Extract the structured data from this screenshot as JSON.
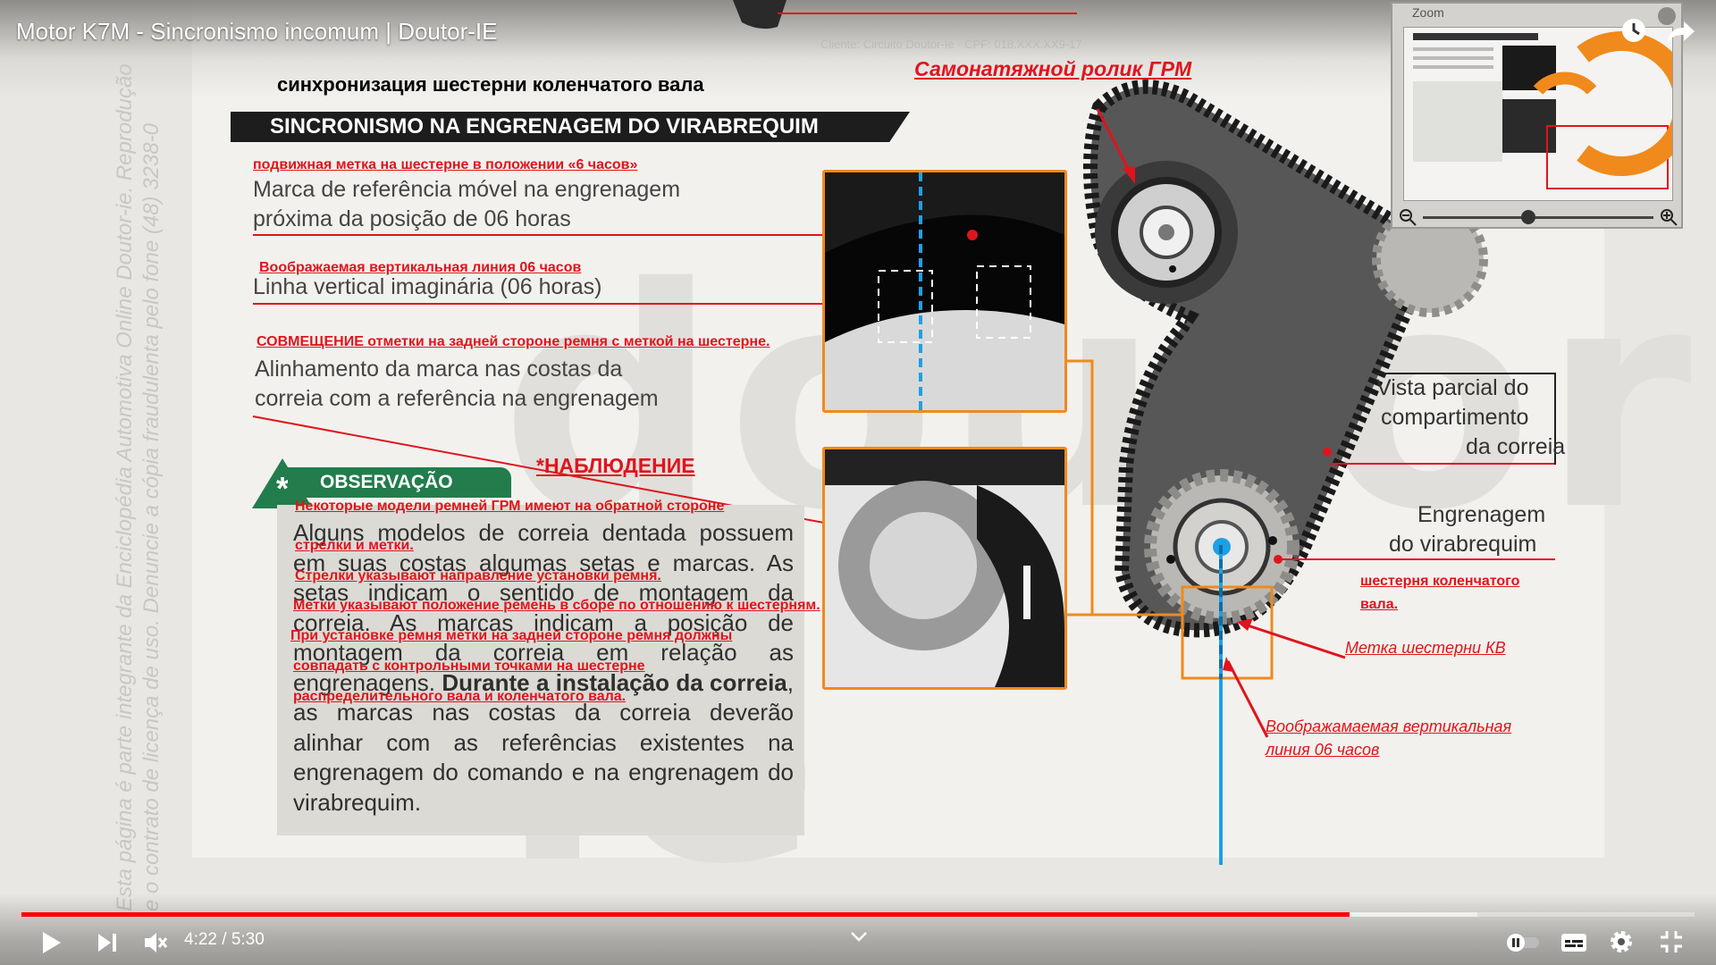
{
  "video": {
    "title": "Motor K7M - Sincronismo incomum | Doutor-IE",
    "time_current": "4:22",
    "time_separator": "/",
    "time_total": "5:30",
    "progress": 0.794,
    "buffered": 0.87
  },
  "page": {
    "client_line": "Cliente: Circuito Doutor-Ie · CPF: 018.XXX.XX9-17",
    "side_watermark_1": "Esta página é parte integrante da Enciclopédia Automotiva Online Doutor-ie. Reprodução",
    "side_watermark_2": "e o contrato de licença de uso. Denuncie a cópia fraudulenta pelo fone (48) 3238-0",
    "big_watermark": "doutor-ie",
    "ru_heading": "синхронизация шестерни коленчатого вала",
    "section_title": "SINCRONISMO NA ENGRENAGEM DO VIRABREQUIM",
    "ann_movable_mark": "подвижная метка на шестерне в положении «6 часов»",
    "pt_movable_1": "Marca de referência móvel na engrenagem",
    "pt_movable_2": "próxima da posição de 06 horas",
    "ann_vertical_line": "Воображаемая вертикальная линия 06 часов",
    "pt_vertical": "Linha vertical imaginária (06 horas)",
    "ann_alignment": "СОВМЕЩЕНИЕ отметки на задней стороне ремня с меткой на шестерне.",
    "pt_align_1": "Alinhamento da marca nas costas da",
    "pt_align_2": "correia com a referência na engrenagem",
    "obs_label": "OBSERVAÇÃO",
    "ann_obs": "*НАБЛЮДЕНИЕ",
    "obs_text_pt_1": "Alguns modelos de correia dentada possuem em suas costas algumas setas e marcas. As setas indicam o sentido de montagem da correia. As marcas indicam a posição de montagem da correia em relação as engrenagens. ",
    "obs_text_pt_bold": "Durante a instalação da correia",
    "obs_text_pt_2": ", as marcas nas costas da correia deverão alinhar com as referências existentes na engrenagem do comando e na engrenagem do virabrequim.",
    "ann_obs_1": "Некоторые модели ремней ГРМ имеют на обратной стороне",
    "ann_obs_2": "стрелки и метки.",
    "ann_obs_3": "Стрелки указывают направление установки ремня.",
    "ann_obs_4": "Метки указывают положение ремень в сборе по  отношению к шестерням.",
    "ann_obs_5": "При установке ремня метки на задней стороне ремня должны",
    "ann_obs_6": "совпадать с контрольными точками на шестерне",
    "ann_obs_7": "распределительного вала и коленчатого вала.",
    "ann_tensioner": "Самонатяжной ролик ГРМ",
    "pt_partial_1": "Vista parcial do",
    "pt_partial_2": "compartimento",
    "pt_partial_3": "da correia",
    "pt_crank_1": "Engrenagem",
    "pt_crank_2": "do virabrequim",
    "ann_crank_gear_1": "шестерня коленчатого",
    "ann_crank_gear_2": "вала.",
    "ann_crank_mark": "Метка шестерни КВ",
    "ann_vline_1": "Воображамаемая вертикальная",
    "ann_vline_2": "линия 06 часов"
  },
  "zoom": {
    "title": "Zoom"
  },
  "colors": {
    "annotation_red": "#e0141c",
    "highlight_orange": "#f08a1c",
    "guide_blue": "#1ea0e6",
    "obs_green": "#237c4c",
    "progress_red": "#ff0000"
  },
  "icons": {
    "play": "play-icon",
    "next": "next-icon",
    "mute": "muted-volume-icon",
    "chevron": "chevron-down-icon",
    "pause_toggle": "autoplay-toggle-icon",
    "subtitles": "subtitles-icon",
    "settings": "gear-icon",
    "fullscreen_exit": "exit-fullscreen-icon",
    "watch_later": "clock-icon",
    "share": "share-arrow-icon",
    "zoom_out": "zoom-out-icon",
    "zoom_in": "zoom-in-icon"
  }
}
